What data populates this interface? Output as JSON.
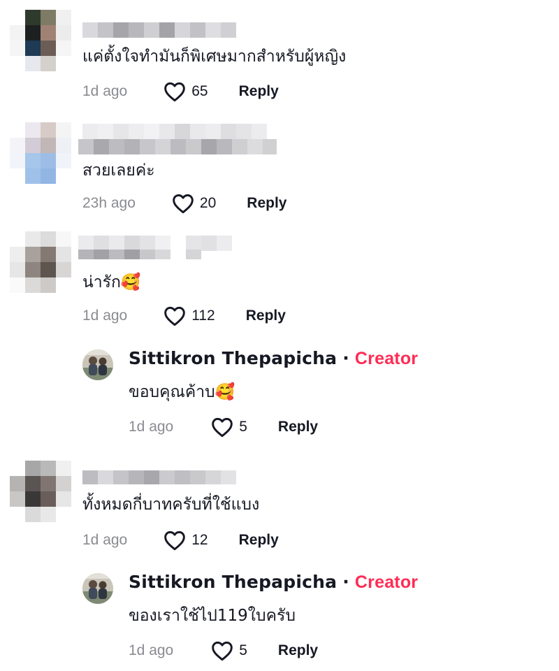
{
  "comments": [
    {
      "text": "แค่ตั้งใจทำมันก็พิเศษมากสำหรับผู้หญิง",
      "time": "1d ago",
      "likes": "65",
      "reply_label": "Reply"
    },
    {
      "text": "สวยเลยค่ะ",
      "time": "23h ago",
      "likes": "20",
      "reply_label": "Reply"
    },
    {
      "text": "น่ารัก🥰",
      "time": "1d ago",
      "likes": "112",
      "reply_label": "Reply",
      "replies": [
        {
          "author": "Sittikron Thepapicha",
          "badge": "Creator",
          "separator": "·",
          "text": "ขอบคุณค้าบ🥰",
          "time": "1d ago",
          "likes": "5",
          "reply_label": "Reply"
        }
      ]
    },
    {
      "text": "ทั้งหมดกี่บาทครับที่ใช้แบง",
      "time": "1d ago",
      "likes": "12",
      "reply_label": "Reply",
      "replies": [
        {
          "author": "Sittikron Thepapicha",
          "badge": "Creator",
          "separator": "·",
          "text": "ของเราใช้ไป119ใบครับ",
          "time": "1d ago",
          "likes": "5",
          "reply_label": "Reply"
        }
      ]
    }
  ],
  "colors": {
    "creator_badge": "#fe2c55",
    "meta_text": "#8a8b91",
    "primary_text": "#161823"
  },
  "icons": {
    "like": "heart-outline-icon"
  }
}
